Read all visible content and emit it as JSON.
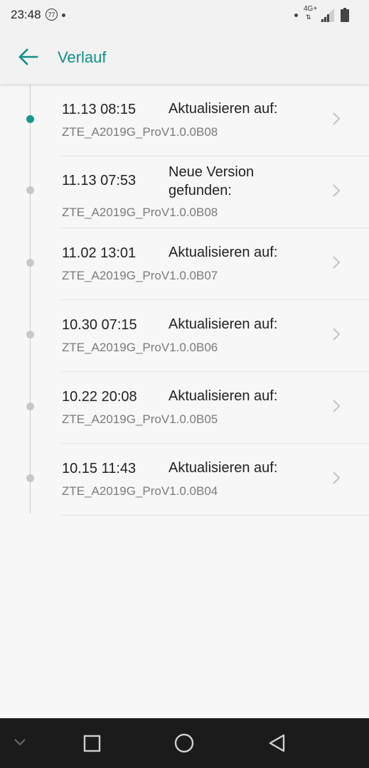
{
  "status_bar": {
    "time": "23:48",
    "notification_badge": "77",
    "network_type": "4G+",
    "data_arrows": "⇅",
    "icons": [
      "circle-badge-icon",
      "signal-icon",
      "battery-icon"
    ]
  },
  "app_bar": {
    "title": "Verlauf",
    "back_icon": "arrow-left-icon",
    "accent_color": "#0f8f87"
  },
  "history": [
    {
      "time": "11.13 08:15",
      "status": "Aktualisieren auf:",
      "version": "ZTE_A2019G_ProV1.0.0B08",
      "active": true
    },
    {
      "time": "11.13 07:53",
      "status": "Neue Version gefunden:",
      "version": "ZTE_A2019G_ProV1.0.0B08",
      "active": false
    },
    {
      "time": "11.02 13:01",
      "status": "Aktualisieren auf:",
      "version": "ZTE_A2019G_ProV1.0.0B07",
      "active": false
    },
    {
      "time": "10.30 07:15",
      "status": "Aktualisieren auf:",
      "version": "ZTE_A2019G_ProV1.0.0B06",
      "active": false
    },
    {
      "time": "10.22 20:08",
      "status": "Aktualisieren auf:",
      "version": "ZTE_A2019G_ProV1.0.0B05",
      "active": false
    },
    {
      "time": "10.15 11:43",
      "status": "Aktualisieren auf:",
      "version": "ZTE_A2019G_ProV1.0.0B04",
      "active": false
    }
  ],
  "nav_bar": {
    "buttons": [
      "chevron-down-icon",
      "recents-square-icon",
      "home-circle-icon",
      "back-triangle-icon"
    ]
  }
}
